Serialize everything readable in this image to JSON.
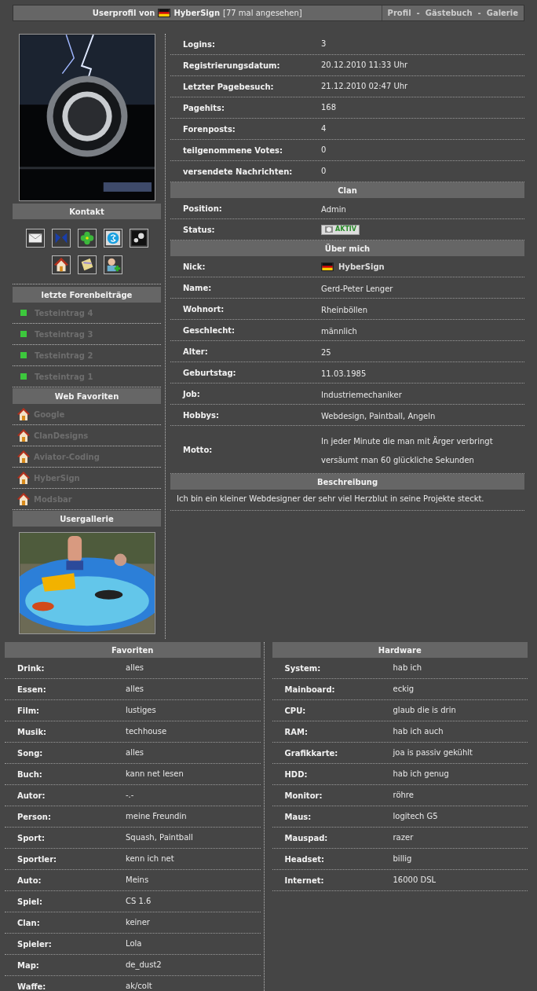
{
  "header": {
    "title_prefix": "Userprofil von",
    "user": "HyberSign",
    "views": "[77 mal angesehen]",
    "links": [
      "Profil",
      "Gästebuch",
      "Galerie"
    ],
    "separator": "-"
  },
  "sidebar": {
    "contact_title": "Kontakt",
    "posts_title": "letzte Forenbeiträge",
    "posts": [
      "Testeintrag 4",
      "Testeintrag 3",
      "Testeintrag 2",
      "Testeintrag 1"
    ],
    "web_title": "Web Favoriten",
    "web": [
      "Google",
      "ClanDesigns",
      "Aviator-Coding",
      "HyberSign",
      "Modsbar"
    ],
    "gallery_title": "Usergallerie"
  },
  "stats": [
    {
      "label": "Logins:",
      "value": "3"
    },
    {
      "label": "Registrierungsdatum:",
      "value": "20.12.2010 11:33 Uhr"
    },
    {
      "label": "Letzter Pagebesuch:",
      "value": "21.12.2010 02:47 Uhr"
    },
    {
      "label": "Pagehits:",
      "value": "168"
    },
    {
      "label": "Forenposts:",
      "value": "4"
    },
    {
      "label": "teilgenommene Votes:",
      "value": "0"
    },
    {
      "label": "versendete Nachrichten:",
      "value": "0"
    }
  ],
  "clan": {
    "title": "Clan",
    "rows": [
      {
        "kind": "text",
        "label": "Position:",
        "value": "Admin"
      },
      {
        "kind": "status",
        "label": "Status:",
        "value": "AKTIV"
      }
    ]
  },
  "about": {
    "title": "Über mich",
    "rows": [
      {
        "kind": "nick",
        "label": "Nick:",
        "value": "HyberSign"
      },
      {
        "kind": "text",
        "label": "Name:",
        "value": "Gerd-Peter Lenger"
      },
      {
        "kind": "text",
        "label": "Wohnort:",
        "value": "Rheinböllen"
      },
      {
        "kind": "text",
        "label": "Geschlecht:",
        "value": "männlich"
      },
      {
        "kind": "text",
        "label": "Alter:",
        "value": "25"
      },
      {
        "kind": "text",
        "label": "Geburtstag:",
        "value": "11.03.1985"
      },
      {
        "kind": "text",
        "label": "Job:",
        "value": "Industriemechaniker"
      },
      {
        "kind": "text",
        "label": "Hobbys:",
        "value": "Webdesign, Paintball, Angeln"
      },
      {
        "kind": "text",
        "label": "Motto:",
        "value": "In jeder Minute die man mit Ärger verbringt versäumt man 60 glückliche Sekunden"
      }
    ]
  },
  "description": {
    "title": "Beschreibung",
    "text": "Ich bin ein kleiner Webdesigner der sehr viel Herzblut in seine Projekte steckt."
  },
  "favorites": {
    "title": "Favoriten",
    "rows": [
      {
        "label": "Drink:",
        "value": "alles"
      },
      {
        "label": "Essen:",
        "value": "alles"
      },
      {
        "label": "Film:",
        "value": "lustiges"
      },
      {
        "label": "Musik:",
        "value": "techhouse"
      },
      {
        "label": "Song:",
        "value": "alles"
      },
      {
        "label": "Buch:",
        "value": "kann net lesen"
      },
      {
        "label": "Autor:",
        "value": "-.-"
      },
      {
        "label": "Person:",
        "value": "meine Freundin"
      },
      {
        "label": "Sport:",
        "value": "Squash, Paintball"
      },
      {
        "label": "Sportler:",
        "value": "kenn ich net"
      },
      {
        "label": "Auto:",
        "value": "Meins"
      },
      {
        "label": "Spiel:",
        "value": "CS 1.6"
      },
      {
        "label": "Clan:",
        "value": "keiner"
      },
      {
        "label": "Spieler:",
        "value": "Lola"
      },
      {
        "label": "Map:",
        "value": "de_dust2"
      },
      {
        "label": "Waffe:",
        "value": "ak/colt"
      }
    ]
  },
  "hardware": {
    "title": "Hardware",
    "rows": [
      {
        "label": "System:",
        "value": "hab ich"
      },
      {
        "label": "Mainboard:",
        "value": "eckig"
      },
      {
        "label": "CPU:",
        "value": "glaub die is drin"
      },
      {
        "label": "RAM:",
        "value": "hab ich auch"
      },
      {
        "label": "Grafikkarte:",
        "value": "joa is passiv gekühlt"
      },
      {
        "label": "HDD:",
        "value": "hab ich genug"
      },
      {
        "label": "Monitor:",
        "value": "röhre"
      },
      {
        "label": "Maus:",
        "value": "logitech G5"
      },
      {
        "label": "Mauspad:",
        "value": "razer"
      },
      {
        "label": "Headset:",
        "value": "billig"
      },
      {
        "label": "Internet:",
        "value": "16000 DSL"
      }
    ]
  }
}
